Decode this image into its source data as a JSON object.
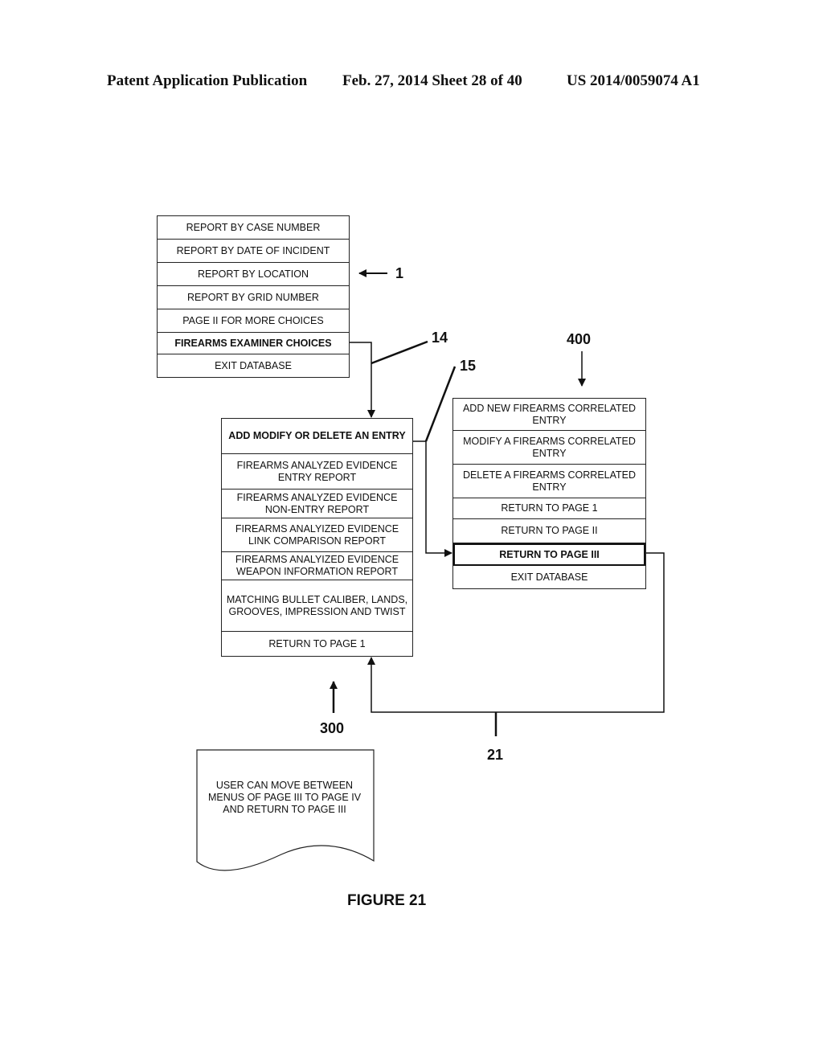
{
  "header": {
    "publication": "Patent Application Publication",
    "date_sheet": "Feb. 27, 2014  Sheet 28 of 40",
    "number": "US 2014/0059074 A1"
  },
  "menu_page1": {
    "ref": "1",
    "items": [
      "REPORT BY CASE NUMBER",
      "REPORT BY DATE OF INCIDENT",
      "REPORT BY LOCATION",
      "REPORT BY GRID NUMBER",
      "PAGE II FOR MORE CHOICES",
      "FIREARMS EXAMINER CHOICES",
      "EXIT DATABASE"
    ]
  },
  "menu_page3": {
    "ref": "300",
    "items": [
      "ADD MODIFY OR DELETE AN ENTRY",
      "FIREARMS ANALYZED EVIDENCE ENTRY REPORT",
      "FIREARMS ANALYZED EVIDENCE NON-ENTRY REPORT",
      "FIREARMS ANALYIZED EVIDENCE LINK COMPARISON REPORT",
      "FIREARMS ANALYIZED EVIDENCE WEAPON INFORMATION REPORT",
      "MATCHING BULLET CALIBER, LANDS, GROOVES, IMPRESSION AND TWIST",
      "RETURN TO PAGE 1"
    ]
  },
  "menu_page4": {
    "ref": "400",
    "items": [
      "ADD NEW FIREARMS CORRELATED ENTRY",
      "MODIFY A FIREARMS CORRELATED ENTRY",
      "DELETE A FIREARMS CORRELATED ENTRY",
      "RETURN TO PAGE 1",
      "RETURN TO PAGE II",
      "RETURN TO PAGE III",
      "EXIT DATABASE"
    ]
  },
  "refs": {
    "r14": "14",
    "r15": "15",
    "r21": "21"
  },
  "note": "USER CAN MOVE BETWEEN MENUS OF PAGE III TO PAGE IV AND RETURN TO PAGE III",
  "figure_label": "FIGURE 21"
}
